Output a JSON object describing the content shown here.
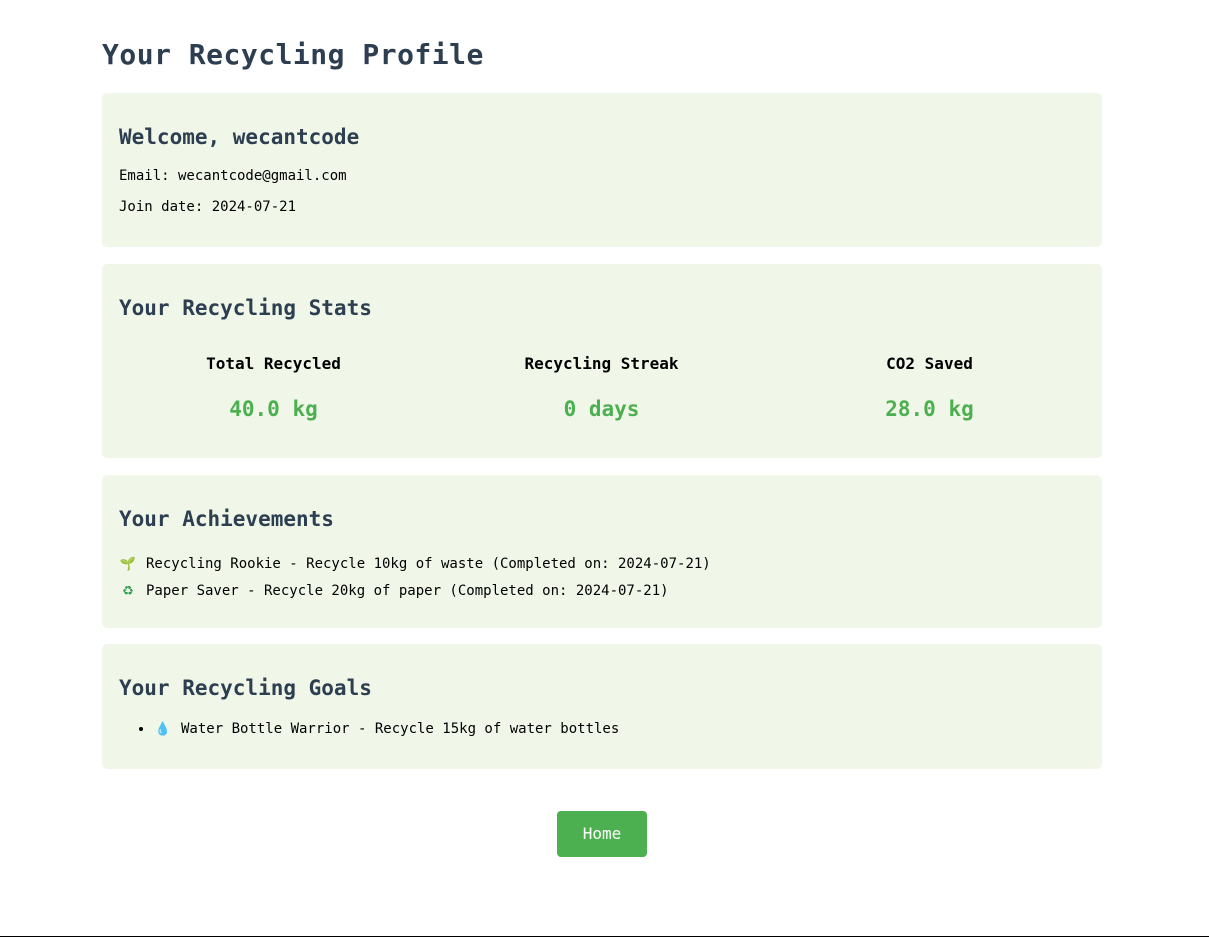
{
  "page": {
    "title": "Your Recycling Profile"
  },
  "profile": {
    "welcome": "Welcome, wecantcode",
    "email_line": "Email: wecantcode@gmail.com",
    "join_line": "Join date: 2024-07-21"
  },
  "stats": {
    "heading": "Your Recycling Stats",
    "items": [
      {
        "label": "Total Recycled",
        "value": "40.0 kg"
      },
      {
        "label": "Recycling Streak",
        "value": "0 days"
      },
      {
        "label": "CO2 Saved",
        "value": "28.0 kg"
      }
    ]
  },
  "achievements": {
    "heading": "Your Achievements",
    "items": [
      {
        "icon": "sprout-icon",
        "glyph": "🌱",
        "text": "Recycling Rookie - Recycle 10kg of waste (Completed on: 2024-07-21)"
      },
      {
        "icon": "recycle-icon",
        "glyph": "♻",
        "text": "Paper Saver - Recycle 20kg of paper (Completed on: 2024-07-21)"
      }
    ]
  },
  "goals": {
    "heading": "Your Recycling Goals",
    "items": [
      {
        "icon": "water-drop-icon",
        "glyph": "💧",
        "text": "Water Bottle Warrior - Recycle 15kg of water bottles"
      }
    ]
  },
  "nav": {
    "home_label": "Home"
  },
  "colors": {
    "accent": "#4caf50",
    "card_background": "#f0f7e9",
    "heading": "#2c3e50"
  }
}
